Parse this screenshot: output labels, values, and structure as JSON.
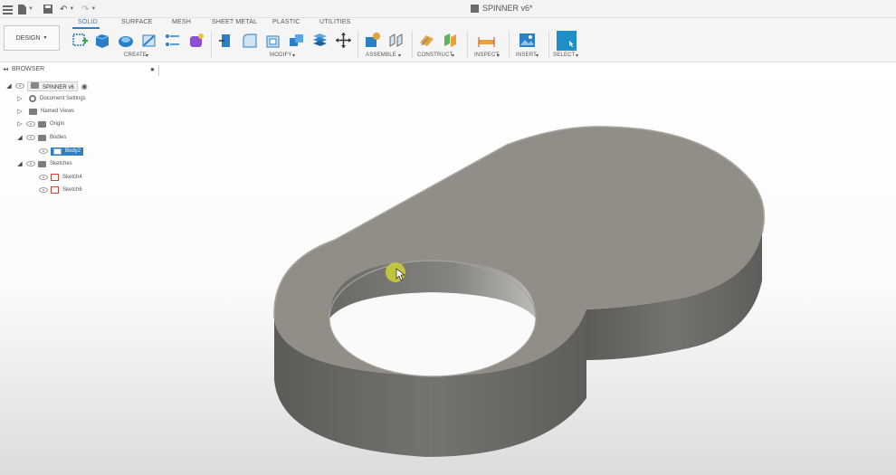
{
  "app": {
    "document_title": "SPINNER v6*"
  },
  "ribbon": {
    "tabs": [
      "SOLID",
      "SURFACE",
      "MESH",
      "SHEET METAL",
      "PLASTIC",
      "UTILITIES"
    ],
    "workspace_button": "DESIGN",
    "groups": [
      "CREATE",
      "MODIFY",
      "ASSEMBLE",
      "CONSTRUCT",
      "INSPECT",
      "INSERT",
      "SELECT"
    ]
  },
  "browser": {
    "title": "BROWSER",
    "root": "SPINNER v6",
    "items": [
      "Document Settings",
      "Named Views",
      "Origin",
      "Bodies",
      "Body2",
      "Sketches",
      "Sketch4",
      "Sketch6"
    ]
  },
  "colors": {
    "accent": "#2e7fc2",
    "select_tool": "#1e90c8",
    "part_top": "#908e87",
    "part_side": "#6e6c68",
    "cursor_highlight": "#c8cc3a"
  }
}
